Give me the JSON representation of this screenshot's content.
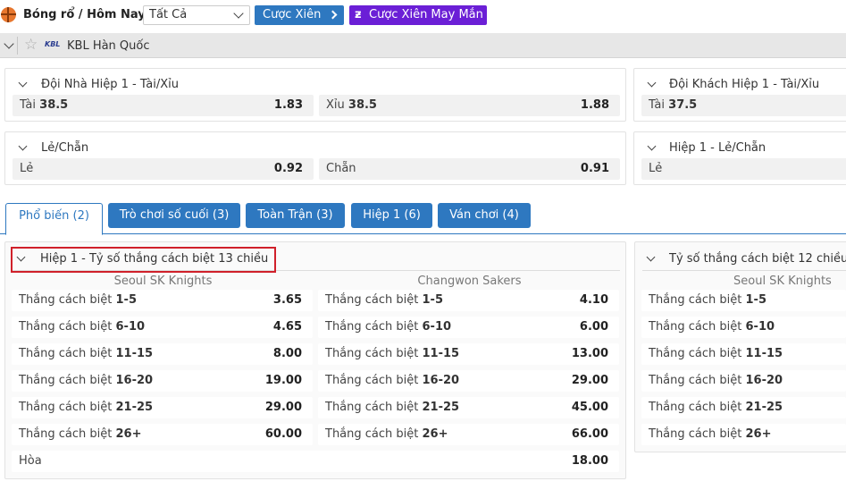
{
  "header": {
    "breadcrumb": "Bóng rổ / Hôm Nay",
    "filter_value": "Tất Cả",
    "parlay_label": "Cược Xiên",
    "lucky_label": "Cược Xiên May Mắn"
  },
  "league": {
    "logo": "KBL",
    "name": "KBL Hàn Quốc"
  },
  "markets": {
    "home_h1_ou": {
      "title": "Đội Nhà Hiệp 1 - Tài/Xỉu",
      "over_label": "Tài",
      "over_line": "38.5",
      "over_odd": "1.83",
      "under_label": "Xỉu",
      "under_line": "38.5",
      "under_odd": "1.88"
    },
    "away_h1_ou": {
      "title": "Đội Khách Hiệp 1 - Tài/Xỉu",
      "over_label": "Tài",
      "over_line": "37.5"
    },
    "odd_even": {
      "title": "Lẻ/Chẵn",
      "odd_label": "Lẻ",
      "odd_odd": "0.92",
      "even_label": "Chẵn",
      "even_odd": "0.91"
    },
    "h1_odd_even": {
      "title": "Hiệp 1 - Lẻ/Chẵn",
      "odd_label": "Lẻ"
    }
  },
  "tabs": [
    {
      "label": "Phổ biến (2)",
      "active": true
    },
    {
      "label": "Trò chơi số cuối (3)",
      "active": false
    },
    {
      "label": "Toàn Trận (3)",
      "active": false
    },
    {
      "label": "Hiệp 1 (6)",
      "active": false
    },
    {
      "label": "Ván chơi (4)",
      "active": false
    }
  ],
  "margin13": {
    "title": "Hiệp 1 - Tỷ số thắng cách biệt 13 chiều",
    "home_team": "Seoul SK Knights",
    "away_team": "Changwon Sakers",
    "prefix": "Thắng cách biệt",
    "rows": [
      {
        "range": "1-5",
        "home": "3.65",
        "away": "4.10"
      },
      {
        "range": "6-10",
        "home": "4.65",
        "away": "6.00"
      },
      {
        "range": "11-15",
        "home": "8.00",
        "away": "13.00"
      },
      {
        "range": "16-20",
        "home": "19.00",
        "away": "29.00"
      },
      {
        "range": "21-25",
        "home": "29.00",
        "away": "45.00"
      },
      {
        "range": "26+",
        "home": "60.00",
        "away": "66.00"
      }
    ],
    "draw_label": "Hòa",
    "draw_odd": "18.00"
  },
  "margin12": {
    "title": "Tỷ số thắng cách biệt 12 chiều",
    "home_team": "Seoul SK Knights",
    "prefix": "Thắng cách biệt",
    "rows": [
      "1-5",
      "6-10",
      "11-15",
      "16-20",
      "21-25",
      "26+"
    ]
  },
  "colors": {
    "primary": "#2e78c0",
    "lucky": "#6b1fd6",
    "highlight": "#d0202a"
  }
}
